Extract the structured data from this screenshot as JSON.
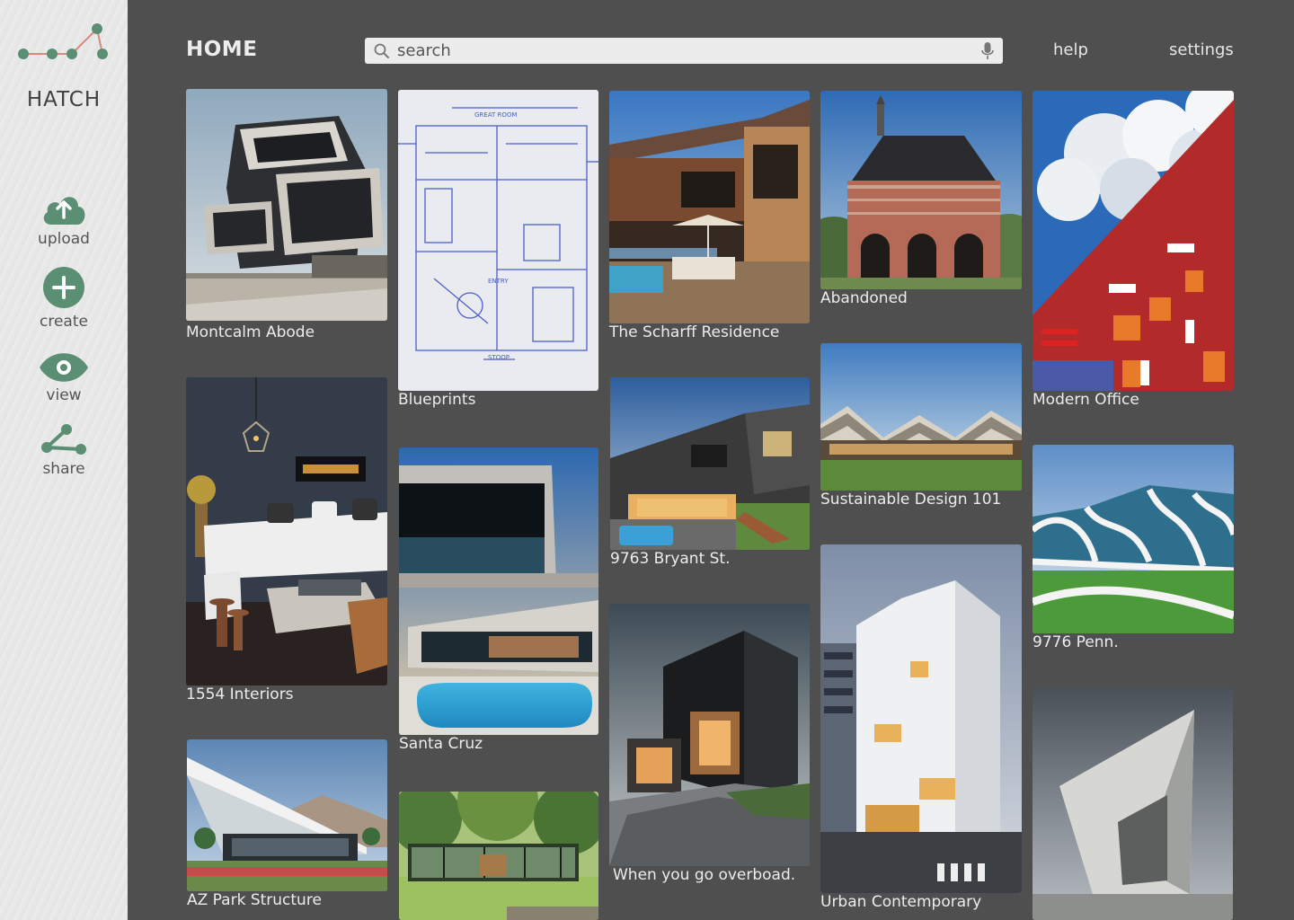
{
  "app": {
    "name": "HATCH"
  },
  "nav": {
    "upload": "upload",
    "create": "create",
    "view": "view",
    "share": "share"
  },
  "header": {
    "title": "HOME",
    "search_placeholder": "search",
    "help": "help",
    "settings": "settings"
  },
  "colors": {
    "accent": "#5b8f74",
    "logo_line": "#d98a7a",
    "background": "#4f4f4f"
  },
  "cards": [
    {
      "caption": "Montcalm Abode"
    },
    {
      "caption": "1554 Interiors"
    },
    {
      "caption": "AZ Park Structure"
    },
    {
      "caption": "Blueprints"
    },
    {
      "caption": "Santa Cruz"
    },
    {
      "caption": ""
    },
    {
      "caption": "The Scharff Residence"
    },
    {
      "caption": "9763 Bryant St."
    },
    {
      "caption": "When you go overboad."
    },
    {
      "caption": "Abandoned"
    },
    {
      "caption": "Sustainable Design 101"
    },
    {
      "caption": "Urban Contemporary"
    },
    {
      "caption": "Modern Office"
    },
    {
      "caption": "9776 Penn."
    },
    {
      "caption": ""
    }
  ]
}
